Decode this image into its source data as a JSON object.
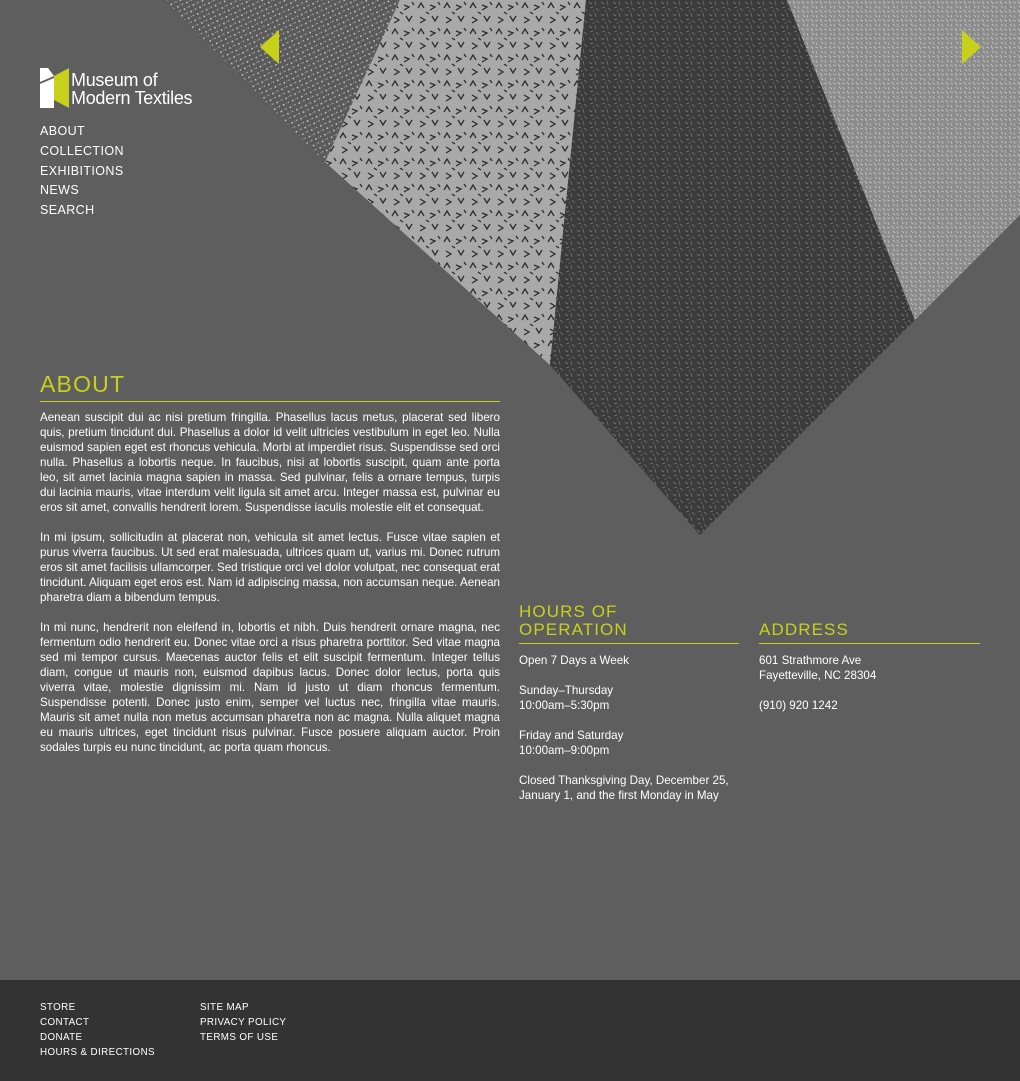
{
  "brand": {
    "line1": "Museum of",
    "line2": "Modern Textiles",
    "accent": "#c7d119"
  },
  "nav": [
    {
      "id": "about",
      "label": "ABOUT"
    },
    {
      "id": "collection",
      "label": "COLLECTION"
    },
    {
      "id": "exhibitions",
      "label": "EXHIBITIONS"
    },
    {
      "id": "news",
      "label": "NEWS"
    },
    {
      "id": "search",
      "label": "SEARCH"
    }
  ],
  "carousel": {
    "prev_icon": "triangle-left-icon",
    "next_icon": "triangle-right-icon"
  },
  "about": {
    "title": "ABOUT",
    "paragraphs": [
      "Aenean suscipit dui ac nisi pretium fringilla. Phasellus lacus metus, placerat sed libero quis, pretium tincidunt dui. Phasellus a dolor id velit ultricies vestibulum in eget leo. Nulla euismod sapien eget est rhoncus vehicula. Morbi at imperdiet risus. Suspendisse sed orci nulla. Phasellus a lobortis neque. In faucibus, nisi at lobortis suscipit, quam ante porta leo, sit amet lacinia magna sapien in massa. Sed pulvinar, felis a ornare tempus, turpis dui lacinia mauris, vitae interdum velit ligula sit amet arcu. Integer massa est, pulvinar eu eros sit amet, convallis hendrerit lorem. Suspendisse iaculis molestie elit et consequat.",
      "In mi ipsum, sollicitudin at placerat non, vehicula sit amet lectus. Fusce vitae sapien et purus viverra faucibus. Ut sed erat malesuada, ultrices quam ut, varius mi. Donec rutrum eros sit amet facilisis ullamcorper. Sed tristique orci vel dolor volutpat, nec consequat erat tincidunt. Aliquam eget eros est. Nam id adipiscing massa, non accumsan neque. Aenean pharetra diam a bibendum tempus.",
      "In mi nunc, hendrerit non eleifend in, lobortis et nibh. Duis hendrerit ornare magna, nec fermentum odio hendrerit eu. Donec vitae orci a risus pharetra porttitor. Sed vitae magna sed mi tempor cursus. Maecenas auctor felis et elit suscipit fermentum. Integer tellus diam, congue ut mauris non, euismod dapibus lacus. Donec dolor lectus, porta quis viverra vitae, molestie dignissim mi. Nam id justo ut diam rhoncus fermentum. Suspendisse potenti. Donec justo enim, semper vel luctus nec, fringilla vitae mauris. Mauris sit amet nulla non metus accumsan pharetra non ac magna. Nulla aliquet magna eu mauris ultrices, eget tincidunt risus pulvinar. Fusce posuere aliquam auctor. Proin sodales turpis eu nunc tincidunt, ac porta quam rhoncus."
    ]
  },
  "hours": {
    "title_line1": "HOURS OF",
    "title_line2": "OPERATION",
    "open": "Open 7 Days a Week",
    "weekday_label": "Sunday–Thursday",
    "weekday_time": "10:00am–5:30pm",
    "weekend_label": "Friday and Saturday",
    "weekend_time": "10:00am–9:00pm",
    "closed": "Closed Thanksgiving Day, December 25, January 1, and the first Monday in May"
  },
  "address": {
    "title": "ADDRESS",
    "street": "601 Strathmore Ave",
    "city": "Fayetteville, NC 28304",
    "phone": "(910) 920 1242"
  },
  "footer": {
    "col1": [
      "STORE",
      "CONTACT",
      "DONATE",
      "HOURS & DIRECTIONS"
    ],
    "col2": [
      "SITE MAP",
      "PRIVACY POLICY",
      "TERMS OF USE"
    ]
  }
}
